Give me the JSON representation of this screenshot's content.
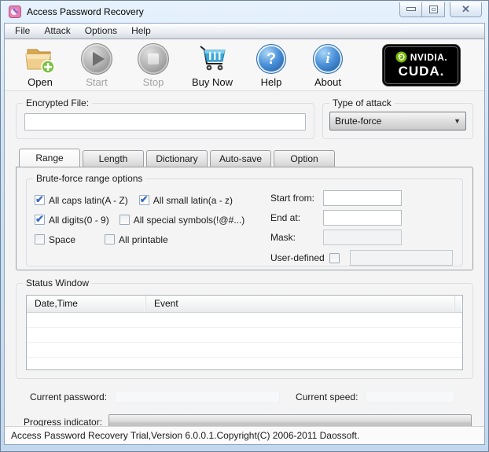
{
  "window": {
    "title": "Access Password Recovery"
  },
  "menu": {
    "items": [
      {
        "label": "File"
      },
      {
        "label": "Attack"
      },
      {
        "label": "Options"
      },
      {
        "label": "Help"
      }
    ]
  },
  "toolbar": {
    "buttons": [
      {
        "label": "Open",
        "icon": "open-folder-icon",
        "enabled": true
      },
      {
        "label": "Start",
        "icon": "start-icon",
        "enabled": false
      },
      {
        "label": "Stop",
        "icon": "stop-icon",
        "enabled": false
      },
      {
        "label": "Buy Now",
        "icon": "shopping-cart-icon",
        "enabled": true
      },
      {
        "label": "Help",
        "icon": "help-icon",
        "enabled": true
      },
      {
        "label": "About",
        "icon": "about-icon",
        "enabled": true
      }
    ],
    "help_glyph": "?",
    "about_glyph": "i",
    "cuda_badge": {
      "brand": "NVIDIA.",
      "product": "CUDA."
    }
  },
  "encrypted_file": {
    "label": "Encrypted File:",
    "value": ""
  },
  "attack_type": {
    "label": "Type of attack",
    "selected": "Brute-force"
  },
  "tabs": {
    "active_index": 0,
    "items": [
      {
        "label": "Range"
      },
      {
        "label": "Length"
      },
      {
        "label": "Dictionary"
      },
      {
        "label": "Auto-save"
      },
      {
        "label": "Option"
      }
    ]
  },
  "range_tab": {
    "group_label": "Brute-force range options",
    "checkboxes": [
      {
        "label": "All caps latin(A - Z)",
        "checked": true
      },
      {
        "label": "All small latin(a - z)",
        "checked": true
      },
      {
        "label": "All digits(0 - 9)",
        "checked": true
      },
      {
        "label": "All special symbols(!@#...)",
        "checked": false
      },
      {
        "label": "Space",
        "checked": false
      },
      {
        "label": "All printable",
        "checked": false
      }
    ],
    "fields": [
      {
        "label": "Start from:",
        "value": "",
        "enabled": true
      },
      {
        "label": "End at:",
        "value": "",
        "enabled": true
      },
      {
        "label": "Mask:",
        "value": "",
        "enabled": false
      }
    ],
    "user_defined": {
      "label": "User-defined",
      "checked": false,
      "value": "",
      "enabled": false
    }
  },
  "status_window": {
    "group_label": "Status Window",
    "columns": [
      "Date,Time",
      "Event"
    ],
    "rows": []
  },
  "bottom": {
    "current_password_label": "Current password:",
    "current_password_value": "",
    "current_speed_label": "Current speed:",
    "current_speed_value": "",
    "progress_label": "Progress indicator:",
    "progress_percent": 0
  },
  "statusbar": {
    "text": "Access Password Recovery Trial,Version 6.0.0.1.Copyright(C) 2006-2011 Daossoft."
  },
  "colors": {
    "accent_blue": "#2e6db4",
    "nvidia_green": "#76b900",
    "check_blue": "#3a6cc4",
    "disabled_text": "#a2a2a2"
  }
}
